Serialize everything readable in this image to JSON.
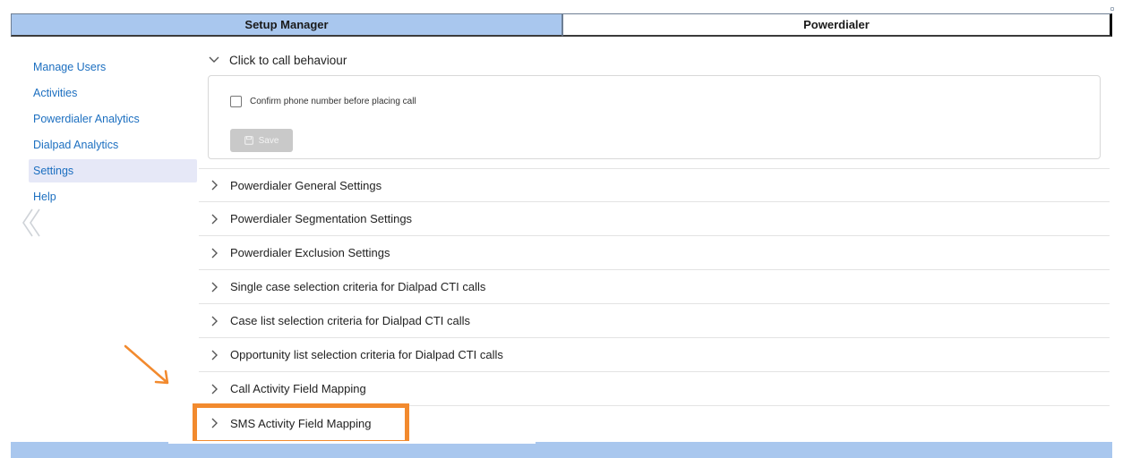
{
  "tabs": {
    "setup_manager": "Setup Manager",
    "powerdialer": "Powerdialer"
  },
  "sidebar": {
    "items": [
      {
        "label": "Manage Users"
      },
      {
        "label": "Activities"
      },
      {
        "label": "Powerdialer Analytics"
      },
      {
        "label": "Dialpad Analytics"
      },
      {
        "label": "Settings",
        "active": true
      },
      {
        "label": "Help"
      }
    ]
  },
  "click_to_call": {
    "title": "Click to call behaviour",
    "checkbox_label": "Confirm phone number before placing call",
    "checkbox_checked": false,
    "save_label": "Save"
  },
  "sections": [
    {
      "label": "Powerdialer General Settings"
    },
    {
      "label": "Powerdialer Segmentation Settings"
    },
    {
      "label": "Powerdialer Exclusion Settings"
    },
    {
      "label": "Single case selection criteria for Dialpad CTI calls"
    },
    {
      "label": "Case list selection criteria for Dialpad CTI calls"
    },
    {
      "label": "Opportunity list selection criteria for Dialpad CTI calls"
    },
    {
      "label": "Call Activity Field Mapping"
    },
    {
      "label": "SMS Activity Field Mapping",
      "highlighted": true
    }
  ],
  "icons": {
    "chevron_down": "chevron-down-icon",
    "chevron_right": "chevron-right-icon",
    "save": "save-icon",
    "collapse": "double-chevron-left-icon"
  },
  "colors": {
    "tab_active": "#a9c7ee",
    "link": "#1c6fc0",
    "highlight": "#f28a2e",
    "sidebar_active": "#e6e8f7"
  }
}
